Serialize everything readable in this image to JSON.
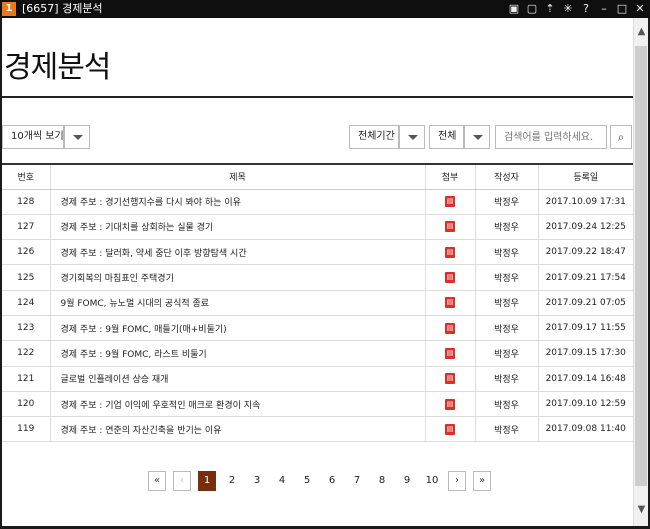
{
  "window": {
    "code": "1",
    "title": "[6657] 경제분석",
    "icons": [
      "mouse-icon",
      "window-icon",
      "pin-icon",
      "star-icon",
      "help-icon",
      "minimize-icon",
      "maximize-icon",
      "close-icon"
    ]
  },
  "page": {
    "title": "경제분석"
  },
  "toolbar": {
    "page_size_label": "10개씩 보기",
    "period_label": "전체기간",
    "scope_label": "전체",
    "search_placeholder": "검색어를 입력하세요."
  },
  "table": {
    "headers": {
      "no": "번호",
      "subject": "제목",
      "attach": "첨부",
      "author": "작성자",
      "date": "등록일"
    },
    "rows": [
      {
        "no": "128",
        "subject": "경제 주보 : 경기선행지수를 다시 봐야 하는 이유",
        "author": "박정우",
        "date": "2017.10.09 17:31"
      },
      {
        "no": "127",
        "subject": "경제 주보 : 기대치를 상회하는 실물 경기",
        "author": "박정우",
        "date": "2017.09.24 12:25"
      },
      {
        "no": "126",
        "subject": "경제 주보 : 달러화, 약세 중단 이후 방향탐색 시간",
        "author": "박정우",
        "date": "2017.09.22 18:47"
      },
      {
        "no": "125",
        "subject": "경기회복의 마침표인 주택경기",
        "author": "박정우",
        "date": "2017.09.21 17:54"
      },
      {
        "no": "124",
        "subject": "9월 FOMC, 뉴노멀 시대의 공식적 종료",
        "author": "박정우",
        "date": "2017.09.21 07:05"
      },
      {
        "no": "123",
        "subject": "경제 주보 : 9월 FOMC, 매들기(매+비둘기)",
        "author": "박정우",
        "date": "2017.09.17 11:55"
      },
      {
        "no": "122",
        "subject": "경제 주보 : 9월 FOMC, 라스트 비둘기",
        "author": "박정우",
        "date": "2017.09.15 17:30"
      },
      {
        "no": "121",
        "subject": "글로벌 인플레이션 상승 재개",
        "author": "박정우",
        "date": "2017.09.14 16:48"
      },
      {
        "no": "120",
        "subject": "경제 주보 : 기업 이익에 우호적인 매크로 환경이 지속",
        "author": "박정우",
        "date": "2017.09.10 12:59"
      },
      {
        "no": "119",
        "subject": "경제 주보 : 연준의 자산긴축을 반기는 이유",
        "author": "박정우",
        "date": "2017.09.08 11:40"
      }
    ]
  },
  "pagination": {
    "first": "«",
    "prev": "‹",
    "pages": [
      "1",
      "2",
      "3",
      "4",
      "5",
      "6",
      "7",
      "8",
      "9",
      "10"
    ],
    "current": "1",
    "next": "›",
    "last": "»"
  },
  "colors": {
    "accent": "#7a2d0c",
    "pdf_icon": "#d9302b",
    "window_badge": "#e57a1e"
  }
}
